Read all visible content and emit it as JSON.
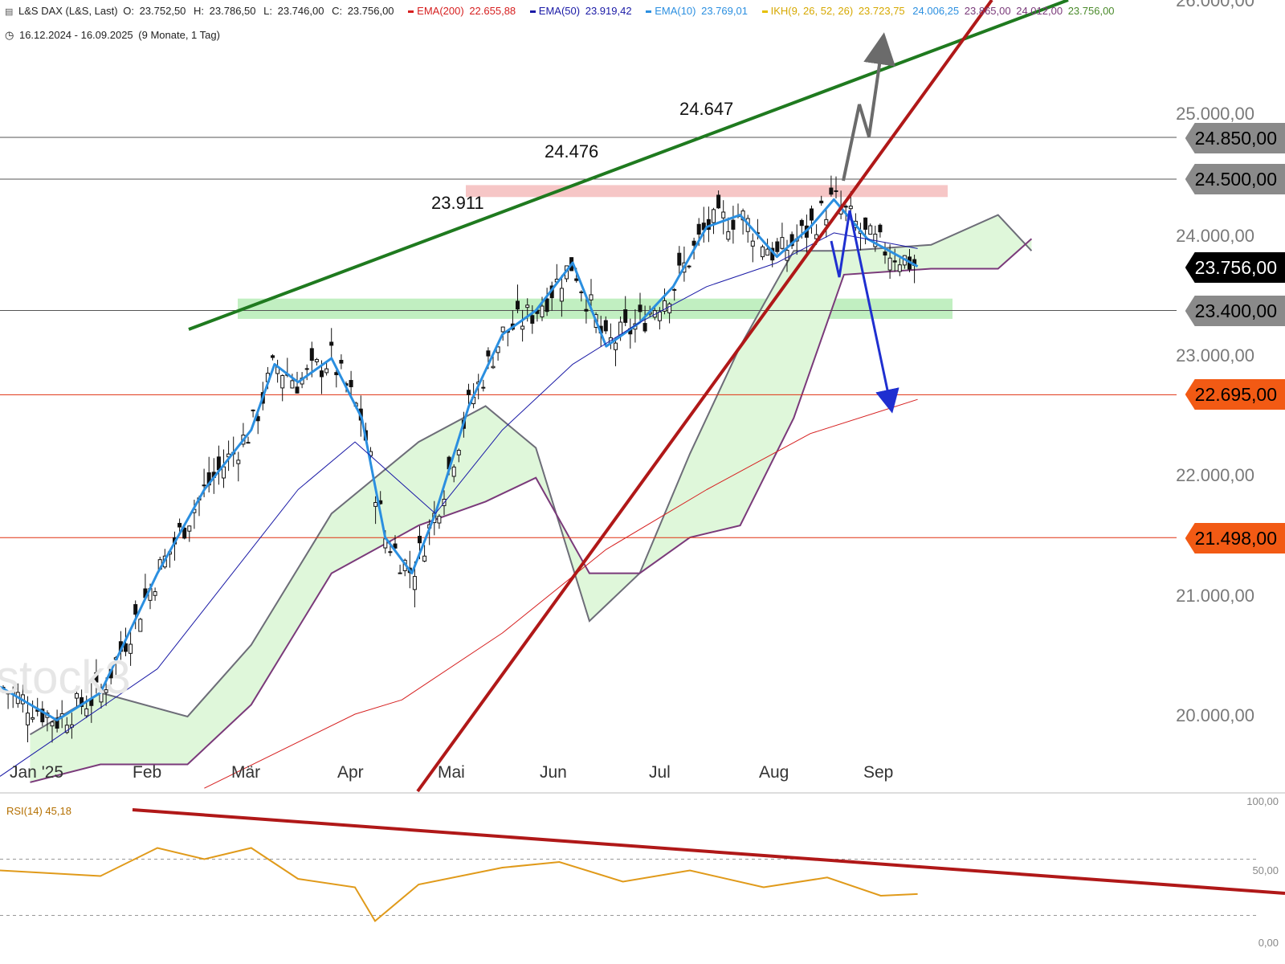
{
  "header": {
    "symbol_icon": "chart-icon",
    "instrument": "L&S DAX (L&S, Last)",
    "ohlc": [
      {
        "label": "O:",
        "value": "23.752,50"
      },
      {
        "label": "H:",
        "value": "23.786,50"
      },
      {
        "label": "L:",
        "value": "23.746,00"
      },
      {
        "label": "C:",
        "value": "23.756,00"
      }
    ],
    "indicators": [
      {
        "name": "EMA(200)",
        "value": "22.655,88",
        "color": "#d62020"
      },
      {
        "name": "EMA(50)",
        "value": "23.919,42",
        "color": "#1a1aa6"
      },
      {
        "name": "EMA(10)",
        "value": "23.769,01",
        "color": "#2b8fe0"
      },
      {
        "name": "IKH(9, 26, 52, 26)",
        "value": "23.723,75",
        "color": "#e6c000"
      }
    ],
    "ikh_values": [
      {
        "value": "24.006,25",
        "color": "#2b8fe0"
      },
      {
        "value": "23.865,00",
        "color": "#7a3a7a"
      },
      {
        "value": "24.012,00",
        "color": "#7a3a7a"
      },
      {
        "value": "23.756,00",
        "color": "#4a8a2a"
      }
    ],
    "clock_icon": "clock-icon",
    "range": "16.12.2024 - 16.09.2025",
    "period": "(9 Monate, 1 Tag)"
  },
  "y_axis_labels": [
    "26.000,00",
    "25.000,00",
    "24.000,00",
    "23.000,00",
    "22.000,00",
    "21.000,00",
    "20.000,00"
  ],
  "price_tags": [
    {
      "label": "24.850,00",
      "value": 24850,
      "bg": "#8a8a8a",
      "fg": "#000000"
    },
    {
      "label": "24.500,00",
      "value": 24500,
      "bg": "#8a8a8a",
      "fg": "#000000"
    },
    {
      "label": "23.756,00",
      "value": 23756,
      "bg": "#000000",
      "fg": "#ffffff"
    },
    {
      "label": "23.400,00",
      "value": 23400,
      "bg": "#8a8a8a",
      "fg": "#000000"
    },
    {
      "label": "22.695,00",
      "value": 22695,
      "bg": "#f25a14",
      "fg": "#000000"
    },
    {
      "label": "21.498,00",
      "value": 21498,
      "bg": "#f25a14",
      "fg": "#000000"
    }
  ],
  "months": [
    "Jan '25",
    "Feb",
    "Mär",
    "Apr",
    "Mai",
    "Jun",
    "Jul",
    "Aug",
    "Sep"
  ],
  "annotations": [
    "24.647",
    "24.476",
    "23.911"
  ],
  "watermark": "stock3",
  "rsi": {
    "legend": "RSI(14) 45,18",
    "labels": [
      "100,00",
      "50,00",
      "0,00"
    ]
  },
  "chart_data": {
    "type": "line",
    "title": "L&S DAX (L&S, Last)",
    "period": "16.12.2024 - 16.09.2025",
    "ylim": [
      19400,
      26000
    ],
    "grid": false,
    "horizontal_levels": [
      24850,
      24500,
      23400,
      22695,
      21498
    ],
    "series": [
      {
        "name": "EMA(10)",
        "x": [
          "2024-12-16",
          "2025-01-02",
          "2025-01-15",
          "2025-02-01",
          "2025-02-15",
          "2025-03-01",
          "2025-03-08",
          "2025-03-15",
          "2025-03-25",
          "2025-04-03",
          "2025-04-10",
          "2025-04-18",
          "2025-04-25",
          "2025-05-05",
          "2025-05-15",
          "2025-05-25",
          "2025-06-05",
          "2025-06-15",
          "2025-06-25",
          "2025-07-05",
          "2025-07-15",
          "2025-07-25",
          "2025-08-05",
          "2025-08-15",
          "2025-08-22",
          "2025-09-01",
          "2025-09-16"
        ],
        "values": [
          20250,
          19970,
          20200,
          21200,
          21900,
          22400,
          22950,
          22800,
          23000,
          22500,
          21500,
          21200,
          21700,
          22600,
          23200,
          23400,
          23800,
          23100,
          23300,
          23600,
          24100,
          24200,
          23850,
          24100,
          24330,
          24000,
          23769
        ]
      },
      {
        "name": "EMA(50)",
        "x": [
          "2024-12-16",
          "2025-02-01",
          "2025-03-15",
          "2025-04-01",
          "2025-04-25",
          "2025-05-15",
          "2025-06-05",
          "2025-06-25",
          "2025-07-15",
          "2025-08-05",
          "2025-08-22",
          "2025-09-16"
        ],
        "values": [
          19500,
          20400,
          21900,
          22300,
          21700,
          22400,
          22950,
          23300,
          23600,
          23800,
          24050,
          23919
        ]
      },
      {
        "name": "EMA(200)",
        "x": [
          "2025-02-15",
          "2025-04-01",
          "2025-04-15",
          "2025-05-15",
          "2025-06-15",
          "2025-07-15",
          "2025-08-15",
          "2025-09-16"
        ],
        "values": [
          19400,
          20020,
          20140,
          20700,
          21400,
          21900,
          22370,
          22656
        ]
      },
      {
        "name": "RSI(14)",
        "x": [
          "2024-12-16",
          "2025-01-15",
          "2025-02-01",
          "2025-02-15",
          "2025-03-01",
          "2025-03-15",
          "2025-04-01",
          "2025-04-07",
          "2025-04-20",
          "2025-05-15",
          "2025-06-01",
          "2025-06-20",
          "2025-07-10",
          "2025-08-01",
          "2025-08-20",
          "2025-09-05",
          "2025-09-16"
        ],
        "values": [
          62,
          58,
          78,
          70,
          78,
          56,
          50,
          26,
          52,
          64,
          68,
          54,
          62,
          50,
          57,
          44,
          45.18
        ]
      }
    ]
  }
}
